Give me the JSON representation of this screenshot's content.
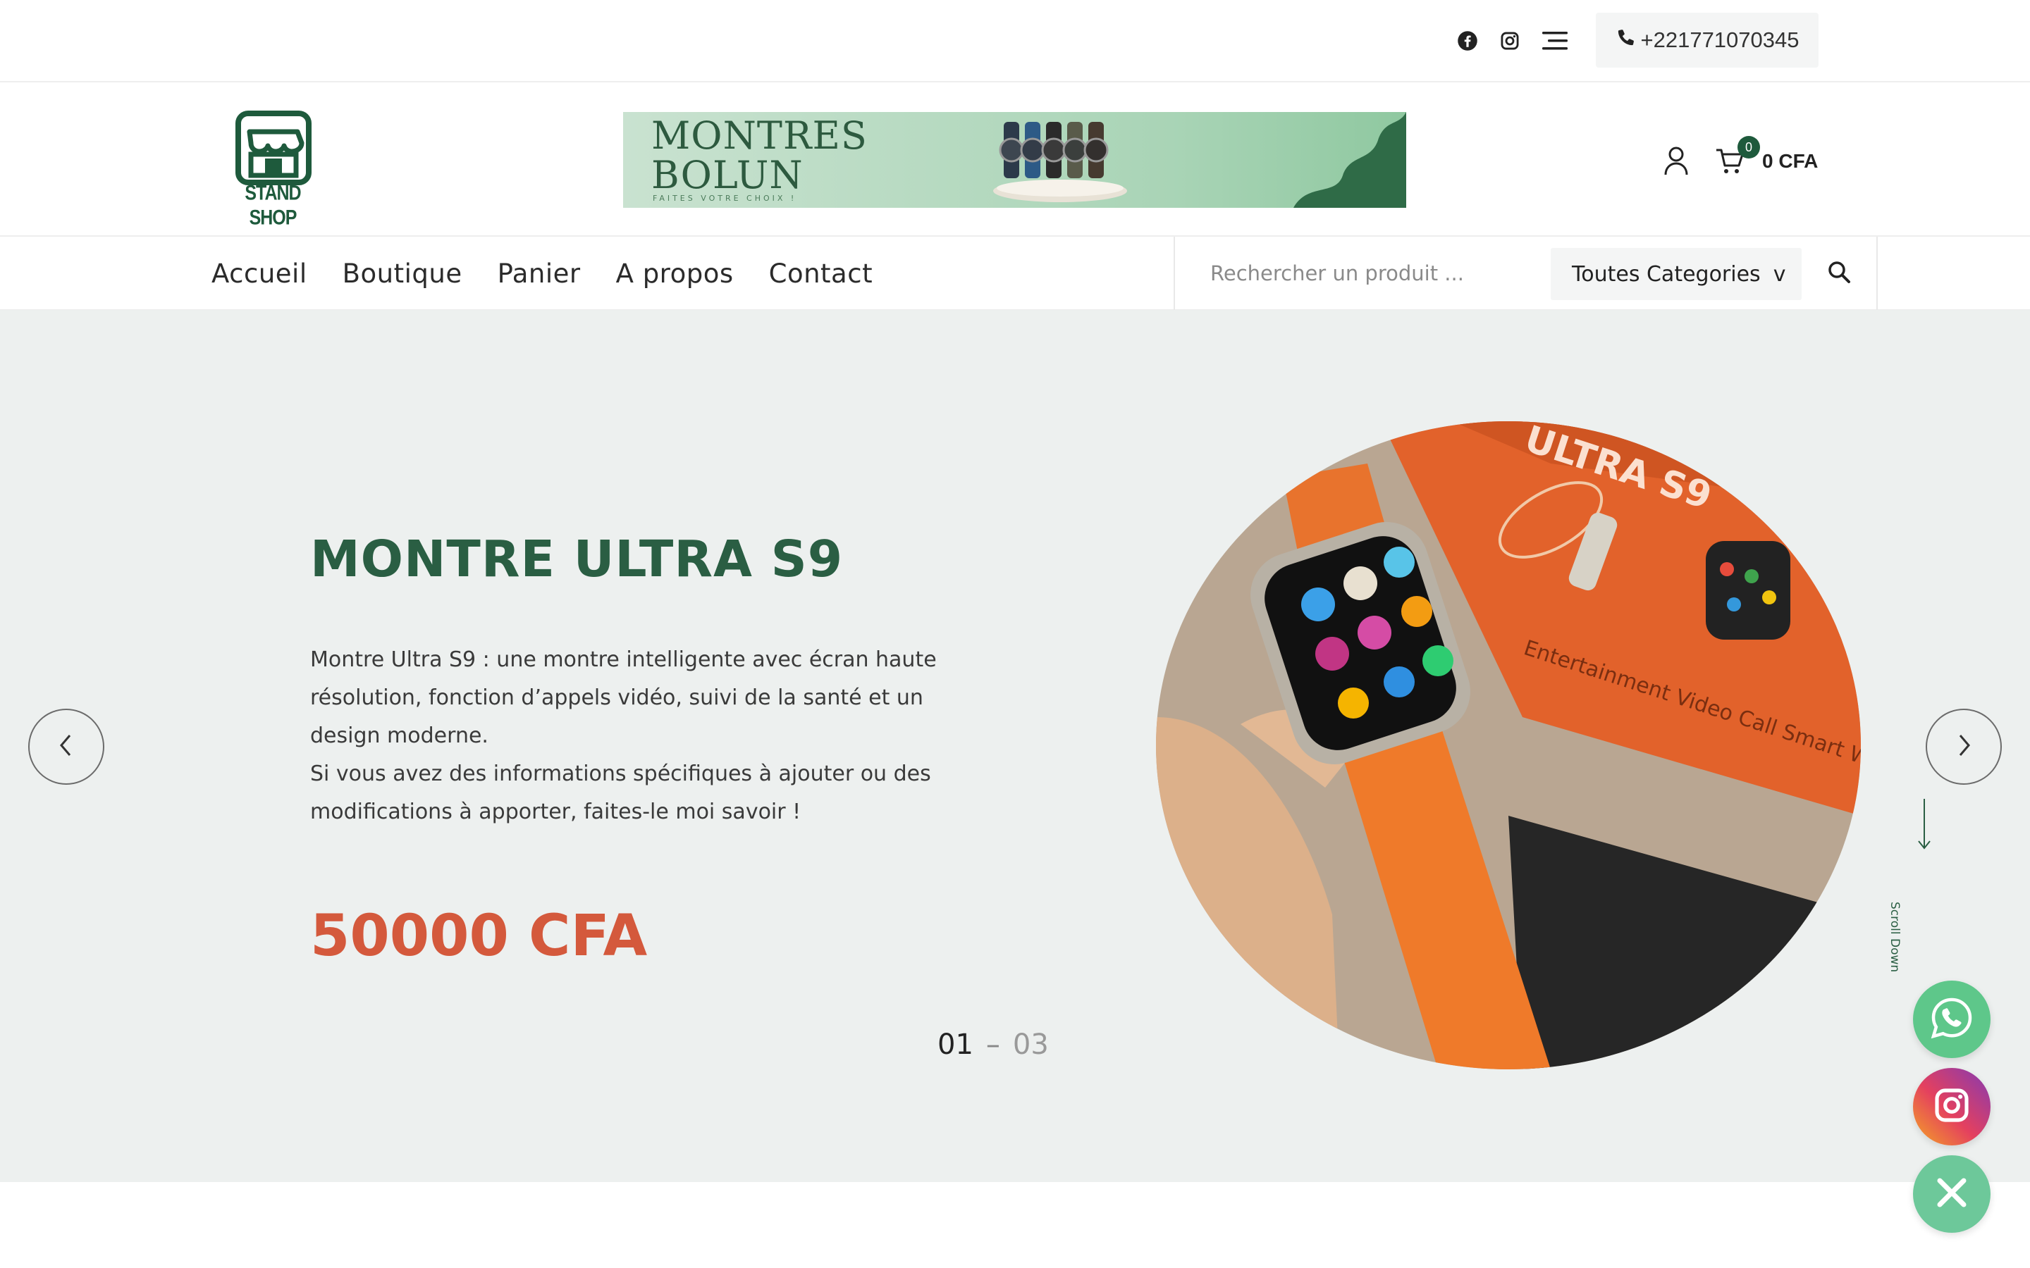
{
  "topbar": {
    "icons": [
      "facebook-icon",
      "instagram-icon",
      "menu-icon"
    ],
    "phone": "+221771070345"
  },
  "header": {
    "logo_text": "STAND SHOP",
    "banner": {
      "title": "MONTRES\nBOLUN",
      "subtitle": "FAITES VOTRE CHOIX !"
    },
    "cart_count": "0",
    "cart_total": "0 CFA"
  },
  "nav": {
    "items": [
      "Accueil",
      "Boutique",
      "Panier",
      "A propos",
      "Contact"
    ],
    "search_placeholder": "Rechercher un produit ...",
    "category_selected": "Toutes Categories",
    "category_caret": "v"
  },
  "hero": {
    "title": "MONTRE ULTRA S9",
    "description_1": "Montre Ultra S9 : une montre intelligente avec écran haute résolution, fonction d’appels vidéo, suivi de la santé et un design moderne.",
    "description_2": "Si vous avez des informations spécifiques à ajouter ou des modifications à apporter, faites-le moi savoir !",
    "price": "50000 CFA",
    "slide_current": "01",
    "slide_separator": "–",
    "slide_total": "03",
    "scroll_label": "Scroll Down"
  },
  "colors": {
    "brand_green": "#2a5e43",
    "price_orange": "#d4593c",
    "hero_bg": "#edf0ef",
    "whatsapp": "#5ec78a"
  }
}
